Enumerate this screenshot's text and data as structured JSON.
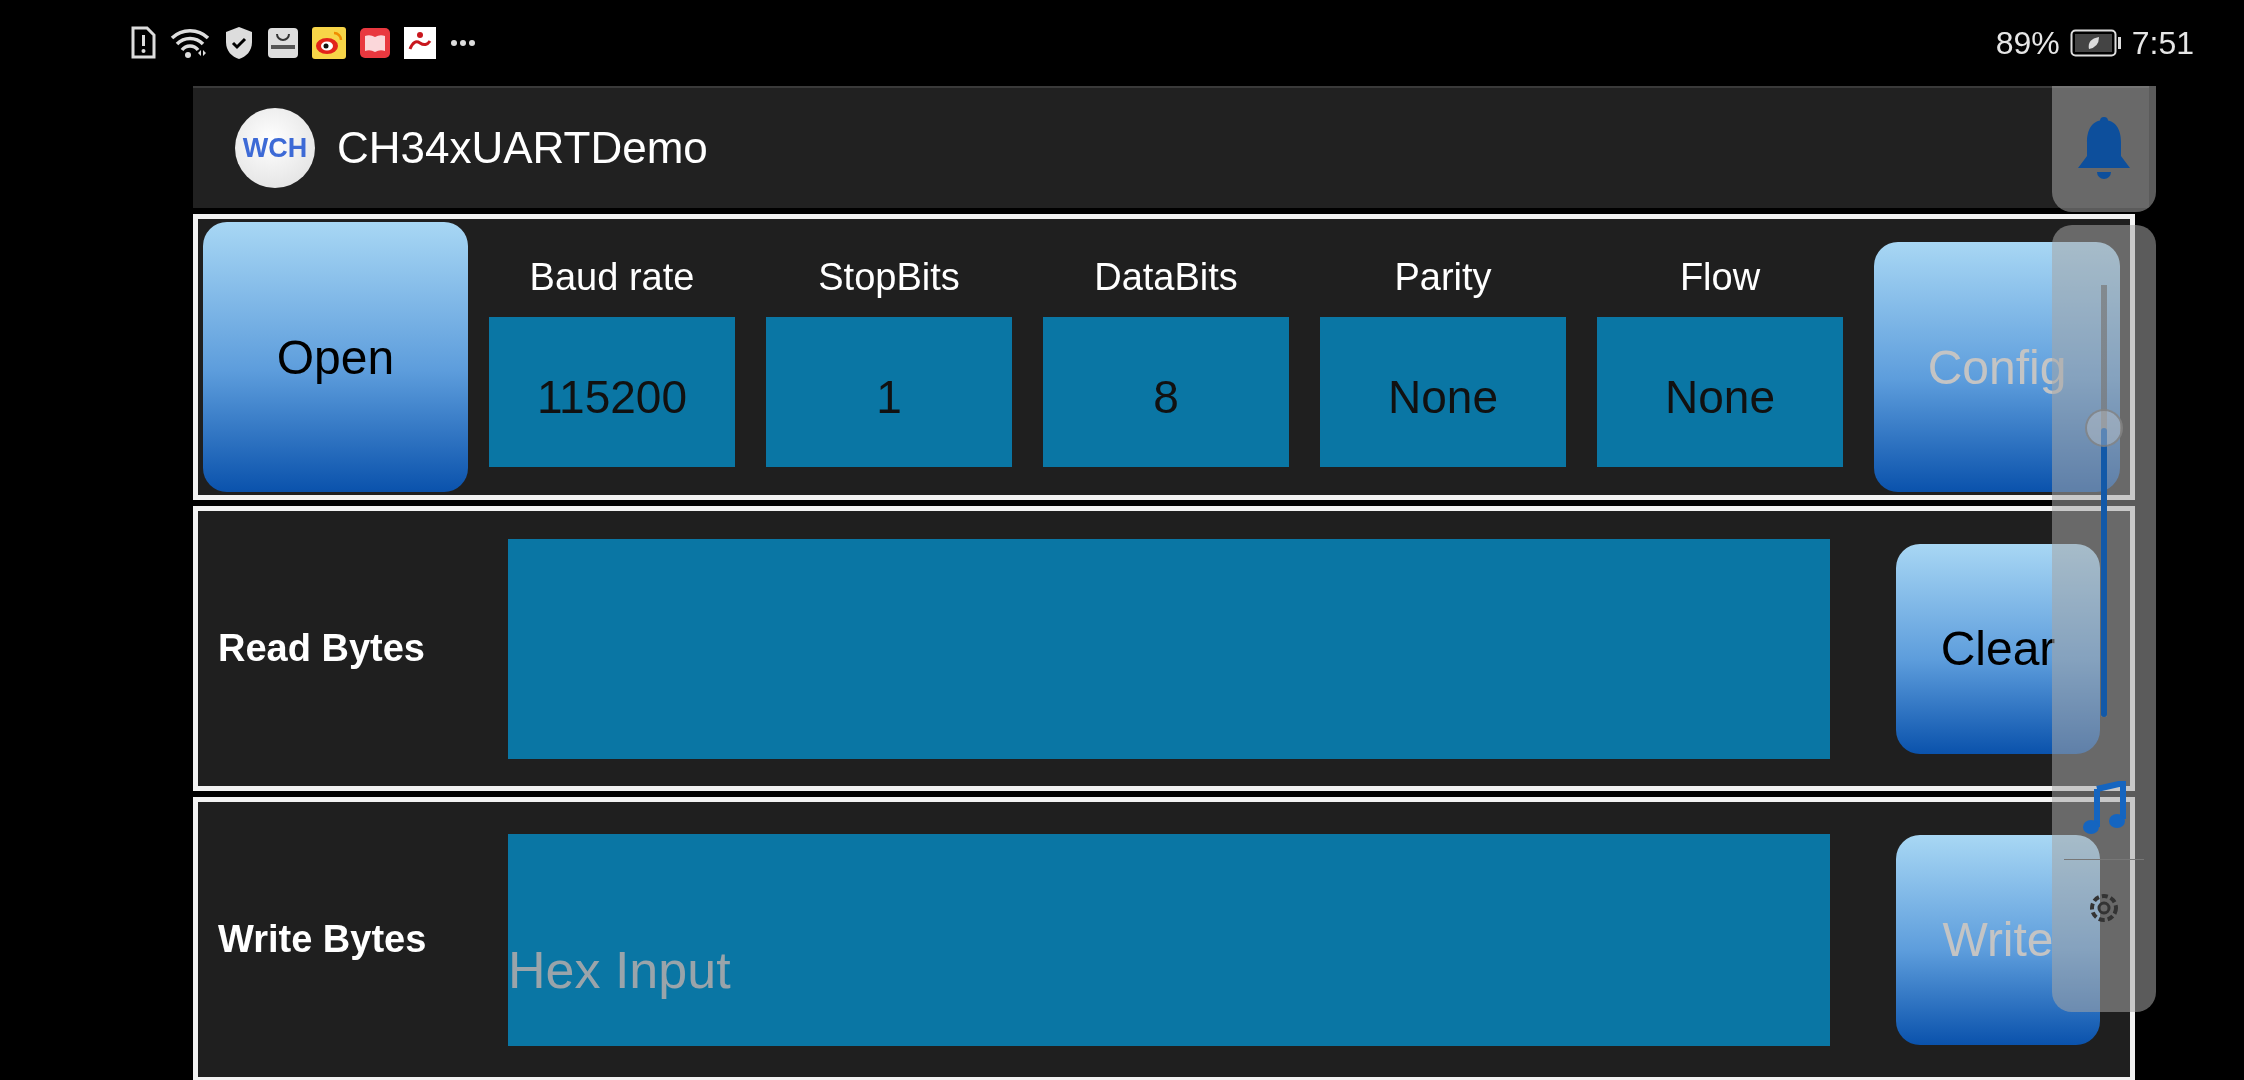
{
  "status_bar": {
    "battery_percent": "89%",
    "time": "7:51"
  },
  "app_bar": {
    "logo_text": "WCH",
    "title": "CH34xUARTDemo"
  },
  "config_panel": {
    "open_button": {
      "label": "Open",
      "disabled": false
    },
    "fields": [
      {
        "label": "Baud rate",
        "value": "115200"
      },
      {
        "label": "StopBits",
        "value": "1"
      },
      {
        "label": "DataBits",
        "value": "8"
      },
      {
        "label": "Parity",
        "value": "None"
      },
      {
        "label": "Flow",
        "value": "None"
      }
    ],
    "config_button": {
      "label": "Config",
      "disabled": true
    }
  },
  "read_panel": {
    "label": "Read Bytes",
    "clear_button": {
      "label": "Clear",
      "disabled": false
    }
  },
  "write_panel": {
    "label": "Write Bytes",
    "placeholder": "Hex Input",
    "write_button": {
      "label": "Write",
      "disabled": true
    }
  },
  "volume_panel": {
    "level": 0.67
  }
}
